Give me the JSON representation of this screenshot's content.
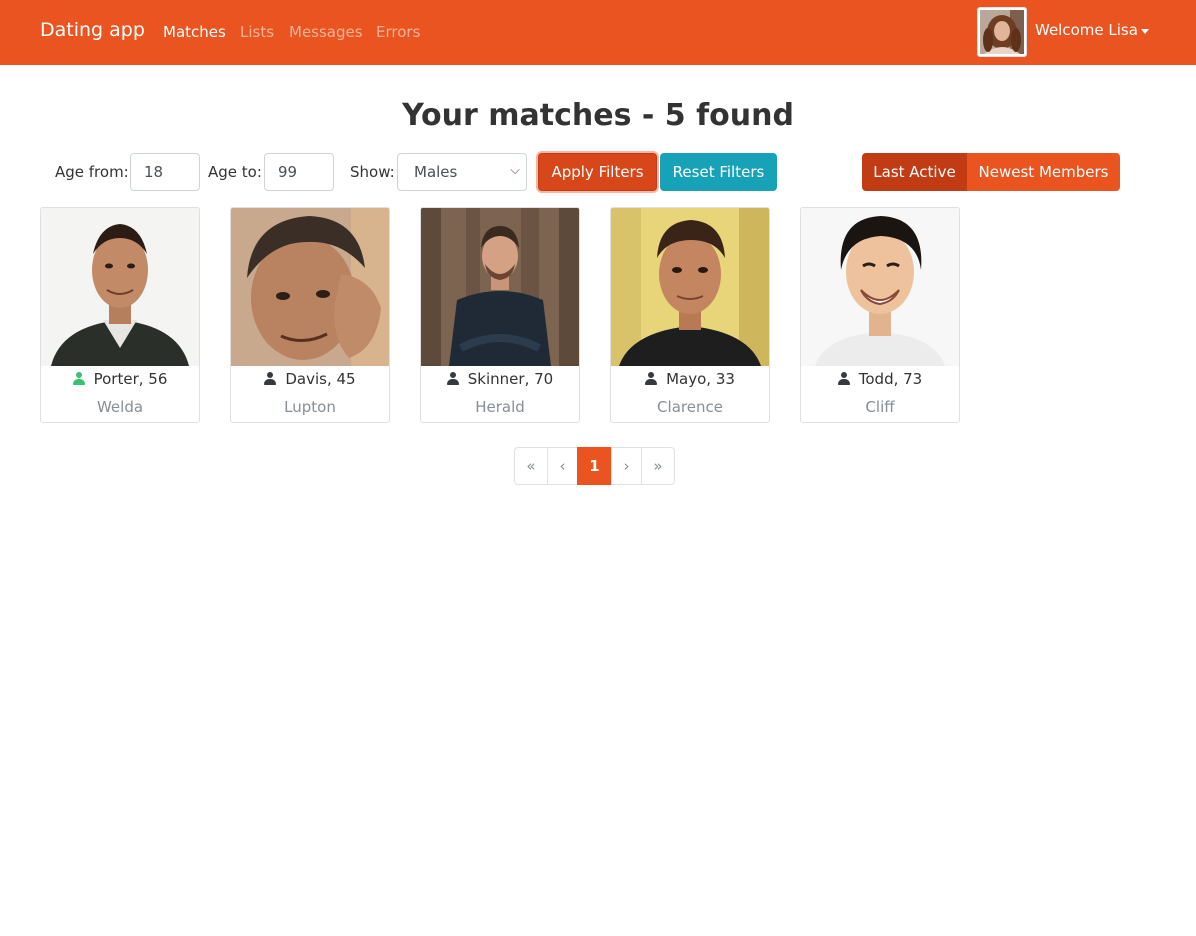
{
  "navbar": {
    "brand": "Dating app",
    "links": [
      "Matches",
      "Lists",
      "Messages",
      "Errors"
    ],
    "welcome": "Welcome Lisa",
    "color": "#e95420"
  },
  "title": "Your matches - 5 found",
  "filters": {
    "age_from_label": "Age from:",
    "age_from_value": "18",
    "age_to_label": "Age to:",
    "age_to_value": "99",
    "show_label": "Show:",
    "show_value": "Males",
    "apply_label": "Apply Filters",
    "reset_label": "Reset Filters"
  },
  "sort": {
    "last_active_label": "Last Active",
    "newest_label": "Newest Members"
  },
  "members": [
    {
      "name": "Porter, 56",
      "city": "Welda",
      "online": true
    },
    {
      "name": "Davis, 45",
      "city": "Lupton",
      "online": false
    },
    {
      "name": "Skinner, 70",
      "city": "Herald",
      "online": false
    },
    {
      "name": "Mayo, 33",
      "city": "Clarence",
      "online": false
    },
    {
      "name": "Todd, 73",
      "city": "Cliff",
      "online": false
    }
  ],
  "pagination": {
    "first": "«",
    "prev": "‹",
    "current": "1",
    "next": "›",
    "last": "»"
  },
  "colors": {
    "accent": "#e95420",
    "info": "#17a2b8",
    "online": "#38c172",
    "offline": "#343a40"
  }
}
